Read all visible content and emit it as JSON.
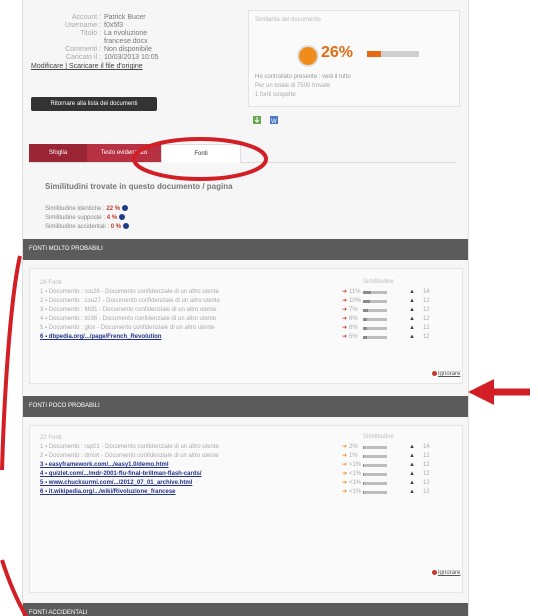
{
  "meta": {
    "rows": [
      {
        "key": "Account :",
        "value": "Patrick Bucer"
      },
      {
        "key": "Username :",
        "value": "f0x5f3"
      },
      {
        "key": "Titolo :",
        "value": "La rivoluzione"
      },
      {
        "key": "",
        "value": "francese.docx"
      },
      {
        "key": "Commenti :",
        "value": "Non disponibile"
      },
      {
        "key": "Caricato il :",
        "value": "10/03/2013 10:05"
      }
    ],
    "links": "Modificare | Scaricare il file d'origine"
  },
  "back_button": "Ritornare alla lista dei documenti",
  "similarity": {
    "label": "Similarità del documento",
    "percent": "26%",
    "level": 0.26,
    "note1": "Ho controllato presente : vedi il tutto",
    "note2": "Per un totale di 7500 trovate",
    "note3": "1 fonti sospette"
  },
  "tabs": [
    "Sfoglia",
    "Testo evidenziato",
    "Fonti"
  ],
  "substitutions_title": "Similitudini trovate in questo documento / pagina",
  "similarities": [
    {
      "label": "Similitudine identiche :",
      "value": "22 %"
    },
    {
      "label": "Similitudine supposte :",
      "value": "4 %"
    },
    {
      "label": "Similitudine accidentali :",
      "value": "0 %"
    }
  ],
  "sections": {
    "probable": {
      "title": "FONTI MOLTO PROBABILI",
      "count_label": "26 Fonti",
      "col_label": "Similitudine",
      "items": [
        {
          "text": "1 ▪ Documento : rou26 - Documento confidenziale di un altro utente",
          "link": false,
          "pct": "11%",
          "fill": 0.11,
          "tail2": "14"
        },
        {
          "text": "2 ▪ Documento : cou27 - Documento confidenziale di un altro utente",
          "link": false,
          "pct": "10%",
          "fill": 0.1,
          "tail2": "12"
        },
        {
          "text": "3 ▪ Documento : fdi31 - Documento confidenziale di un altro utente",
          "link": false,
          "pct": "7%",
          "fill": 0.07,
          "tail2": "12"
        },
        {
          "text": "4 ▪ Documento : tcl36 - Documento confidenziale di un altro utente",
          "link": false,
          "pct": "6%",
          "fill": 0.06,
          "tail2": "12"
        },
        {
          "text": "5 ▪ Documento : glox - Documento confidenziale di un altro utente",
          "link": false,
          "pct": "6%",
          "fill": 0.06,
          "tail2": "12"
        },
        {
          "text": "6 ▪ dbpedia.org/.../page/French_Revolution",
          "link": true,
          "pct": "5%",
          "fill": 0.05,
          "tail2": "12"
        }
      ],
      "ignore": "Ignorare"
    },
    "less": {
      "title": "FONTI POCO PROBABILI",
      "count_label": "22 Fonti",
      "col_label": "Similitudine",
      "items": [
        {
          "text": "1 ▪ Documento : rap01 - Documento confidenziale di un altro utente",
          "link": false,
          "pct": "2%",
          "fill": 0.02,
          "tail2": "14"
        },
        {
          "text": "2 ▪ Documento : dmsrt - Documento confidenziale di un altro utente",
          "link": false,
          "pct": "1%",
          "fill": 0.01,
          "tail2": "12"
        },
        {
          "text": "3 ▪ easyframework.com/.../easy1.0/demo.html",
          "link": true,
          "pct": "<1%",
          "fill": 0.01,
          "tail2": "12"
        },
        {
          "text": "4 ▪ quizlet.com/.../mdr-2001-flu-final-brillman-flash-cards/",
          "link": true,
          "pct": "<1%",
          "fill": 0.01,
          "tail2": "12"
        },
        {
          "text": "5 ▪ www.chucksurmi.com/.../2012_07_01_archive.html",
          "link": true,
          "pct": "<1%",
          "fill": 0.01,
          "tail2": "12"
        },
        {
          "text": "6 ▪ it.wikipedia.org/.../wiki/Rivoluzione_francese",
          "link": true,
          "pct": "<1%",
          "fill": 0.01,
          "tail2": "12"
        }
      ],
      "ignore": "Ignorare"
    },
    "accidental": {
      "title": "FONTI ACCIDENTALI"
    }
  },
  "colors": {
    "accent": "#e56b12",
    "tab": "#9a2534",
    "annotation": "#d21f26",
    "header": "#5b5b5b"
  }
}
